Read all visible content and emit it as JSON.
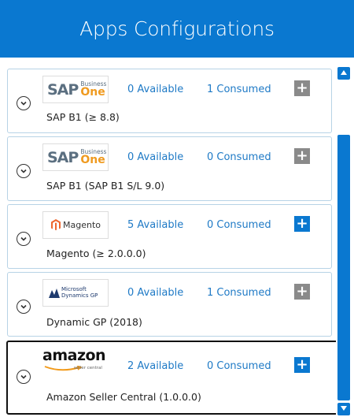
{
  "header": {
    "title": "Apps Configurations"
  },
  "apps": [
    {
      "logo": "sap-business-one",
      "logo_text": {
        "main": "SAP",
        "sub1": "Business",
        "sub2": "One"
      },
      "available": "0 Available",
      "consumed": "1 Consumed",
      "name": "SAP B1 (≥ 8.8)",
      "add_enabled": false
    },
    {
      "logo": "sap-business-one",
      "logo_text": {
        "main": "SAP",
        "sub1": "Business",
        "sub2": "One"
      },
      "available": "0 Available",
      "consumed": "0 Consumed",
      "name": "SAP B1 (SAP B1 S/L 9.0)",
      "add_enabled": false
    },
    {
      "logo": "magento",
      "logo_text": {
        "main": "Magento"
      },
      "available": "5 Available",
      "consumed": "0 Consumed",
      "name": "Magento (≥ 2.0.0.0)",
      "add_enabled": true
    },
    {
      "logo": "microsoft-dynamics-gp",
      "logo_text": {
        "main": "Microsoft",
        "sub1": "Dynamics GP"
      },
      "available": "0 Available",
      "consumed": "1 Consumed",
      "name": "Dynamic GP (2018)",
      "add_enabled": false
    },
    {
      "logo": "amazon",
      "logo_text": {
        "main": "amazon",
        "sub1": "seller central"
      },
      "available": "2 Available",
      "consumed": "0 Consumed",
      "name": "Amazon Seller Central (1.0.0.0)",
      "add_enabled": true,
      "selected": true
    }
  ],
  "plus_symbol": "+",
  "colors": {
    "accent": "#0a78d0",
    "disabled": "#8a8a8a",
    "link": "#1f7ac6"
  }
}
